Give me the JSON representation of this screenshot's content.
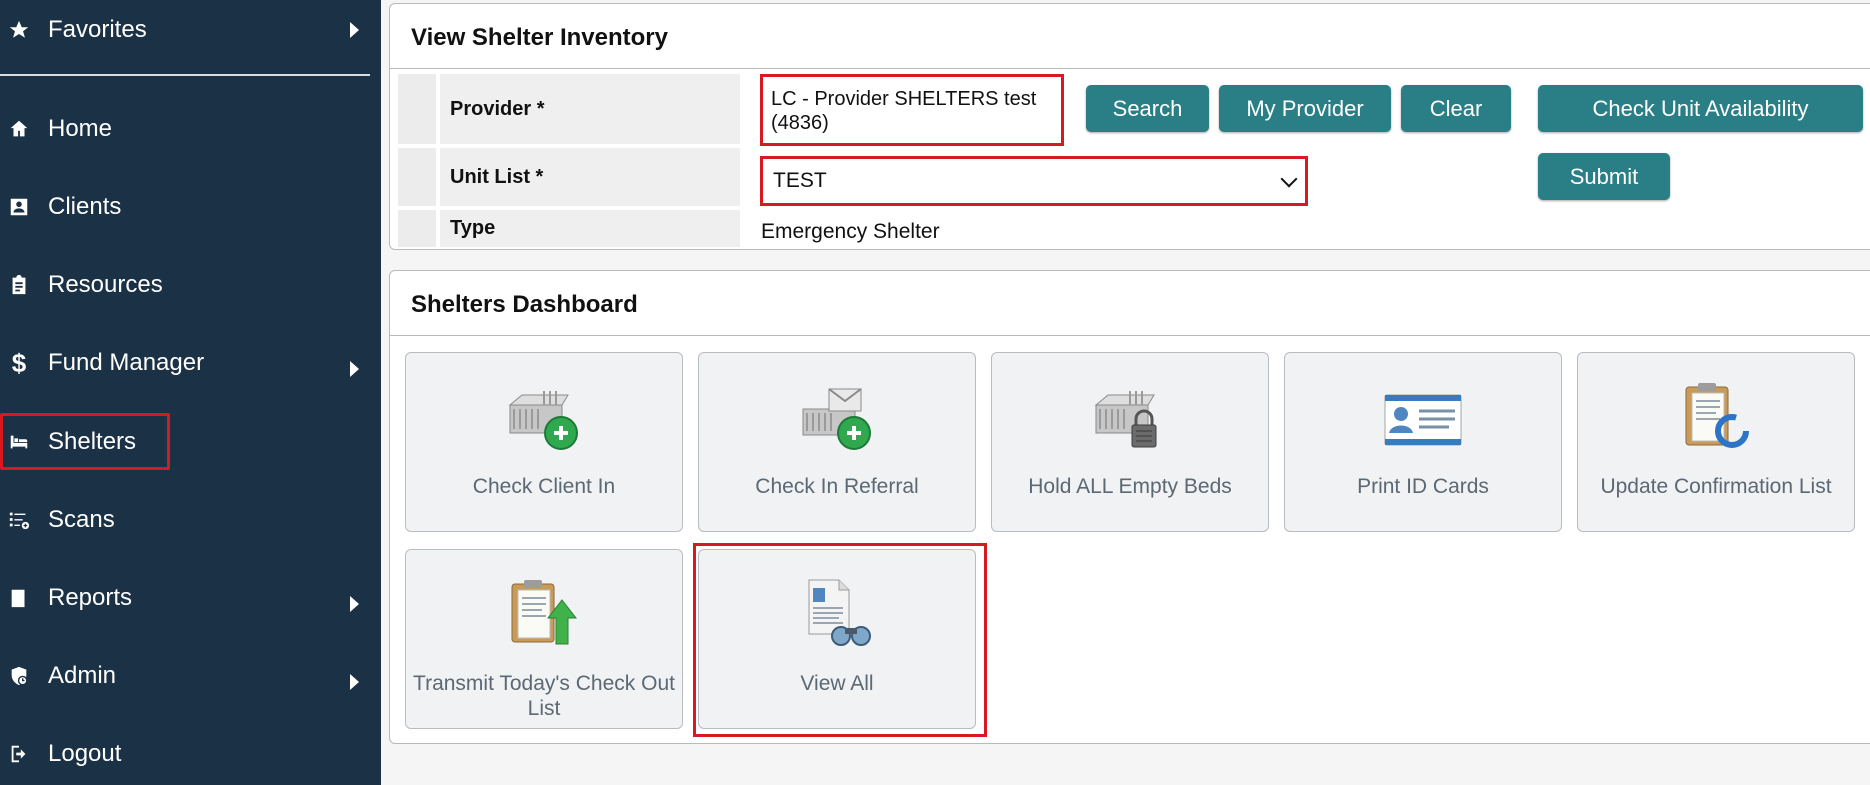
{
  "sidebar": {
    "items": [
      {
        "label": "Favorites",
        "icon": "star-icon",
        "has_submenu": true
      },
      {
        "label": "Home",
        "icon": "home-icon",
        "has_submenu": false
      },
      {
        "label": "Clients",
        "icon": "client-card-icon",
        "has_submenu": false
      },
      {
        "label": "Resources",
        "icon": "clipboard-icon",
        "has_submenu": false
      },
      {
        "label": "Fund Manager",
        "icon": "dollar-icon",
        "has_submenu": true
      },
      {
        "label": "Shelters",
        "icon": "bed-icon",
        "has_submenu": false
      },
      {
        "label": "Scans",
        "icon": "scan-list-icon",
        "has_submenu": false
      },
      {
        "label": "Reports",
        "icon": "report-icon",
        "has_submenu": true
      },
      {
        "label": "Admin",
        "icon": "shield-icon",
        "has_submenu": true
      },
      {
        "label": "Logout",
        "icon": "logout-icon",
        "has_submenu": false
      }
    ],
    "highlighted_item": "Shelters"
  },
  "inventory": {
    "title": "View Shelter Inventory",
    "provider_label": "Provider *",
    "provider_value_line1": "LC - Provider SHELTERS test",
    "provider_value_line2": "(4836)",
    "unit_list_label": "Unit List *",
    "unit_list_value": "TEST",
    "type_label": "Type",
    "type_value": "Emergency Shelter",
    "buttons": {
      "search": "Search",
      "my_provider": "My Provider",
      "clear": "Clear",
      "check_unit_availability": "Check Unit Availability",
      "submit": "Submit"
    }
  },
  "dashboard": {
    "title": "Shelters Dashboard",
    "tiles": [
      {
        "label": "Check Client In",
        "icon": "bed-add-icon"
      },
      {
        "label": "Check In Referral",
        "icon": "referral-add-icon"
      },
      {
        "label": "Hold ALL Empty Beds",
        "icon": "bed-lock-icon"
      },
      {
        "label": "Print ID Cards",
        "icon": "id-card-icon"
      },
      {
        "label": "Update Confirmation List",
        "icon": "clipboard-refresh-icon"
      },
      {
        "label": "Transmit Today's Check Out List",
        "icon": "clipboard-upload-icon"
      },
      {
        "label": "View All",
        "icon": "document-binoculars-icon"
      }
    ]
  },
  "colors": {
    "sidebar_bg": "#1b3145",
    "button_teal": "#2a7f86",
    "highlight_red": "#d71920"
  }
}
